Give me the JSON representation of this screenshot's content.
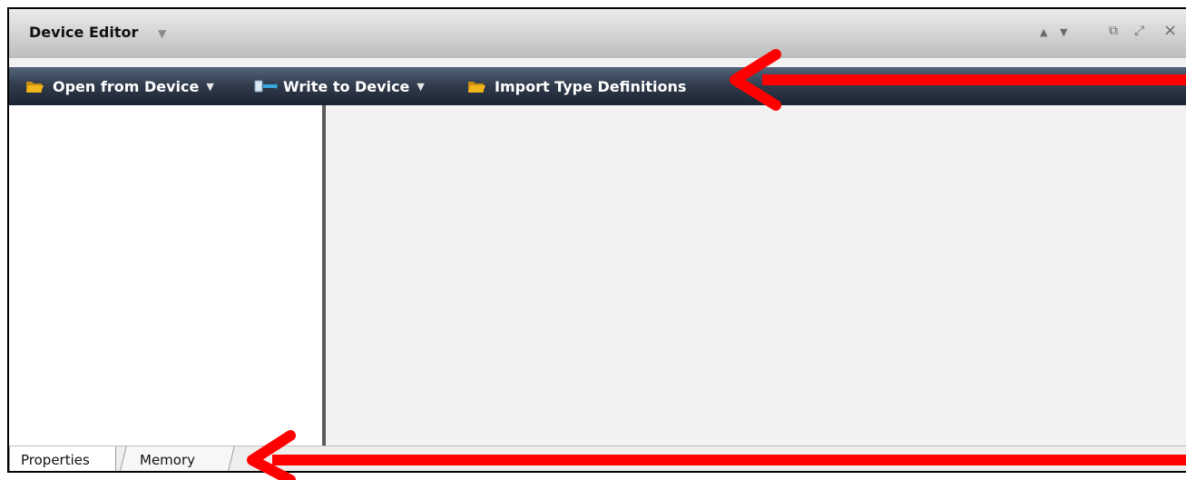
{
  "window": {
    "title": "Device Editor",
    "title_dropdown_glyph": "▼",
    "nav_up_glyph": "▲",
    "nav_down_glyph": "▼",
    "restore_glyph": "⧉",
    "maximize_glyph": "⤢",
    "close_glyph": "×"
  },
  "toolbar": {
    "open_label": "Open from Device",
    "write_label": "Write to Device",
    "import_label": "Import Type Definitions",
    "caret": "▼",
    "icons": {
      "open": "folder-icon",
      "write": "device-write-icon",
      "import": "folder-icon"
    }
  },
  "tabs": {
    "properties_label": "Properties",
    "memory_label": "Memory"
  },
  "colors": {
    "toolbar_top": "#53647a",
    "toolbar_bottom": "#1b2431",
    "annotation_arrow": "#ff0000",
    "folder": "#f2b51c",
    "write_icon": "#38a8e0"
  }
}
